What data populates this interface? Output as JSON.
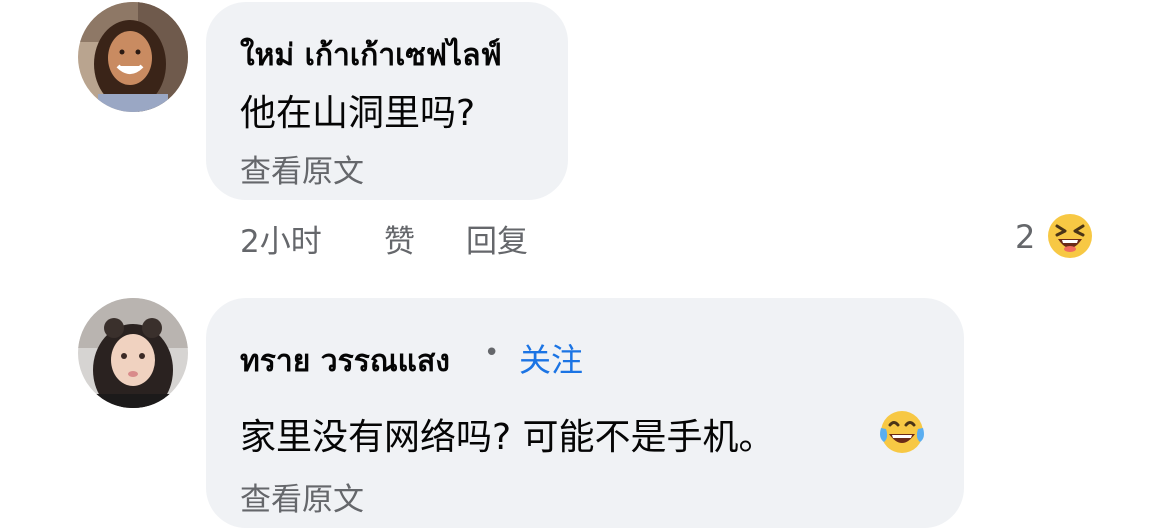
{
  "comments": [
    {
      "author": "ใหม่ เก้าเก้าเซฟไลฟ์",
      "text": "他在山洞里吗?",
      "see_original": "查看原文",
      "time": "2小时",
      "like": "赞",
      "reply": "回复",
      "reaction_count": "2",
      "reaction_icon": "laughing-squint-emoji"
    },
    {
      "author": "ทราย วรรณแสง",
      "separator": "•",
      "follow": "关注",
      "text": "家里没有网络吗? 可能不是手机。",
      "text_emoji": "tears-of-joy-emoji",
      "see_original": "查看原文"
    }
  ],
  "colors": {
    "bubble": "#f0f2f5",
    "secondary_text": "#65676b",
    "link": "#1b74e4",
    "emoji_yellow": "#f7c844"
  }
}
